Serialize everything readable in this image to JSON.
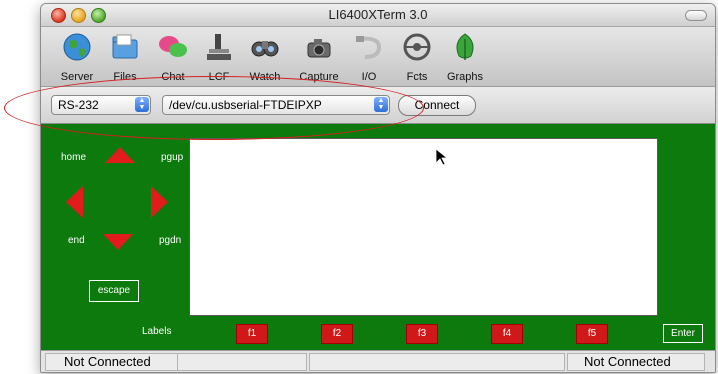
{
  "window": {
    "title": "LI6400XTerm 3.0"
  },
  "toolbar": {
    "items": [
      {
        "label": "Server",
        "icon": "globe-icon"
      },
      {
        "label": "Files",
        "icon": "folder-icon"
      },
      {
        "label": "Chat",
        "icon": "chat-bubbles-icon"
      },
      {
        "label": "LCF",
        "icon": "lcf-icon"
      },
      {
        "label": "Watch",
        "icon": "binoculars-icon"
      },
      {
        "label": "Capture",
        "icon": "camera-icon"
      },
      {
        "label": "I/O",
        "icon": "cable-icon"
      },
      {
        "label": "Fcts",
        "icon": "steering-wheel-icon"
      },
      {
        "label": "Graphs",
        "icon": "leaf-icon"
      }
    ]
  },
  "connection": {
    "port_type": "RS-232",
    "device": "/dev/cu.usbserial-FTDEIPXP",
    "connect_label": "Connect"
  },
  "nav": {
    "home": "home",
    "pgup": "pgup",
    "end": "end",
    "pgdn": "pgdn",
    "escape": "escape"
  },
  "function_keys": {
    "labels_caption": "Labels",
    "keys": [
      "f1",
      "f2",
      "f3",
      "f4",
      "f5"
    ],
    "enter": "Enter"
  },
  "status": {
    "left": "Not Connected",
    "right": "Not Connected"
  },
  "colors": {
    "panel_green": "#0c7a0c",
    "key_red": "#d01818",
    "annotation_red": "#d42020"
  }
}
